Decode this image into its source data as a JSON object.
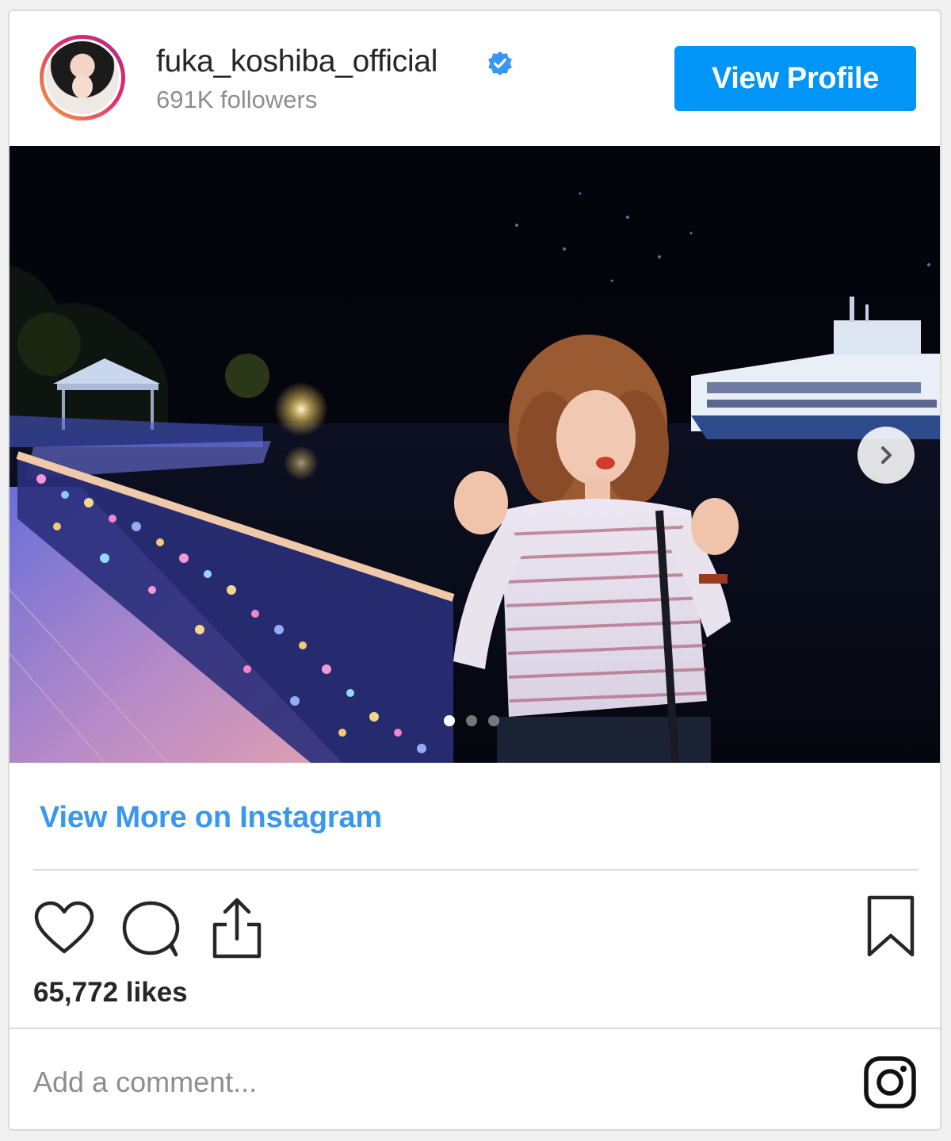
{
  "header": {
    "username": "fuka_koshiba_official",
    "followers": "691K followers",
    "view_profile_label": "View Profile"
  },
  "post": {
    "image_description_icon": "photo",
    "carousel": {
      "total_slides": 3,
      "active_slide": 1
    }
  },
  "links": {
    "view_more": "View More on Instagram"
  },
  "stats": {
    "likes": "65,772 likes"
  },
  "comment": {
    "placeholder": "Add a comment..."
  },
  "colors": {
    "accent": "#0095f6",
    "link": "#3897f0",
    "text": "#262626",
    "muted": "#8e8e8e",
    "border": "#dbdbdb"
  },
  "icons": [
    "verified-badge-icon",
    "chevron-right-icon",
    "heart-icon",
    "comment-icon",
    "share-icon",
    "bookmark-icon",
    "instagram-icon"
  ]
}
